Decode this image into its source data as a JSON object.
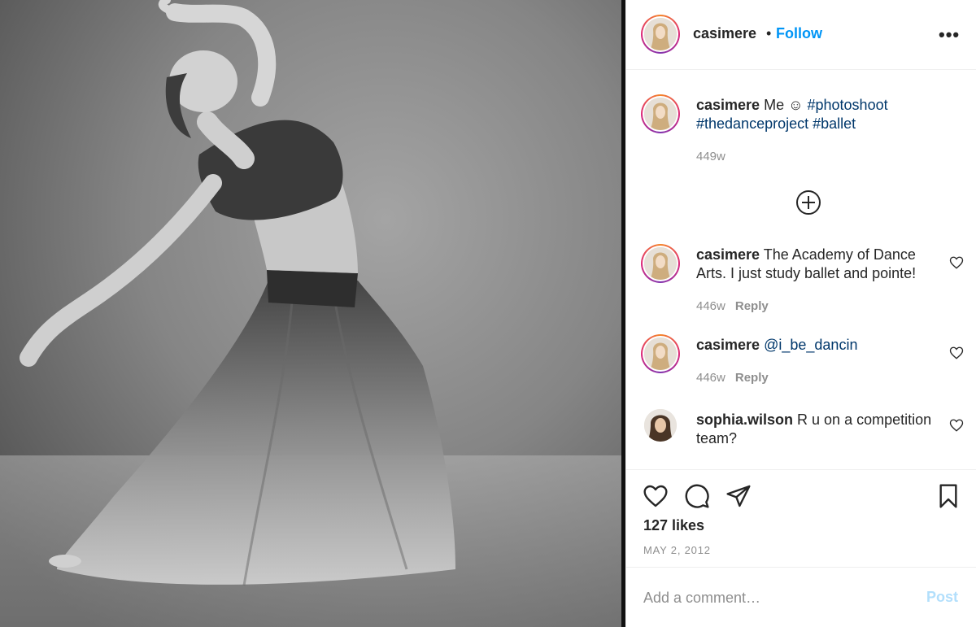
{
  "post": {
    "image_alt": "Black and white photo of a dancer in a long sheer skirt arching backward"
  },
  "header": {
    "username": "casimere",
    "separator": "•",
    "follow_label": "Follow",
    "more_label": "•••"
  },
  "caption": {
    "username": "casimere",
    "text": "Me ☺",
    "hashtags": [
      "#photoshoot",
      "#thedanceproject",
      "#ballet"
    ],
    "time": "449w"
  },
  "load_more_icon": "plus-circle-icon",
  "comments": [
    {
      "username": "casimere",
      "text": "The Academy of Dance Arts. I just study ballet and pointe!",
      "time": "446w",
      "reply_label": "Reply"
    },
    {
      "username": "casimere",
      "text": "@i_be_dancin",
      "time": "446w",
      "reply_label": "Reply"
    },
    {
      "username": "sophia.wilson",
      "text": "R u on a competition team?"
    }
  ],
  "actions": {
    "likes": "127 likes",
    "date": "MAY 2, 2012",
    "icons": [
      "heart-icon",
      "comment-icon",
      "share-icon",
      "bookmark-icon"
    ]
  },
  "add_comment": {
    "placeholder": "Add a comment…",
    "post_label": "Post"
  },
  "colors": {
    "accent": "#0095f6",
    "hashtag": "#00376b",
    "muted": "#8e8e8e",
    "post_disabled": "#b2dffc"
  }
}
